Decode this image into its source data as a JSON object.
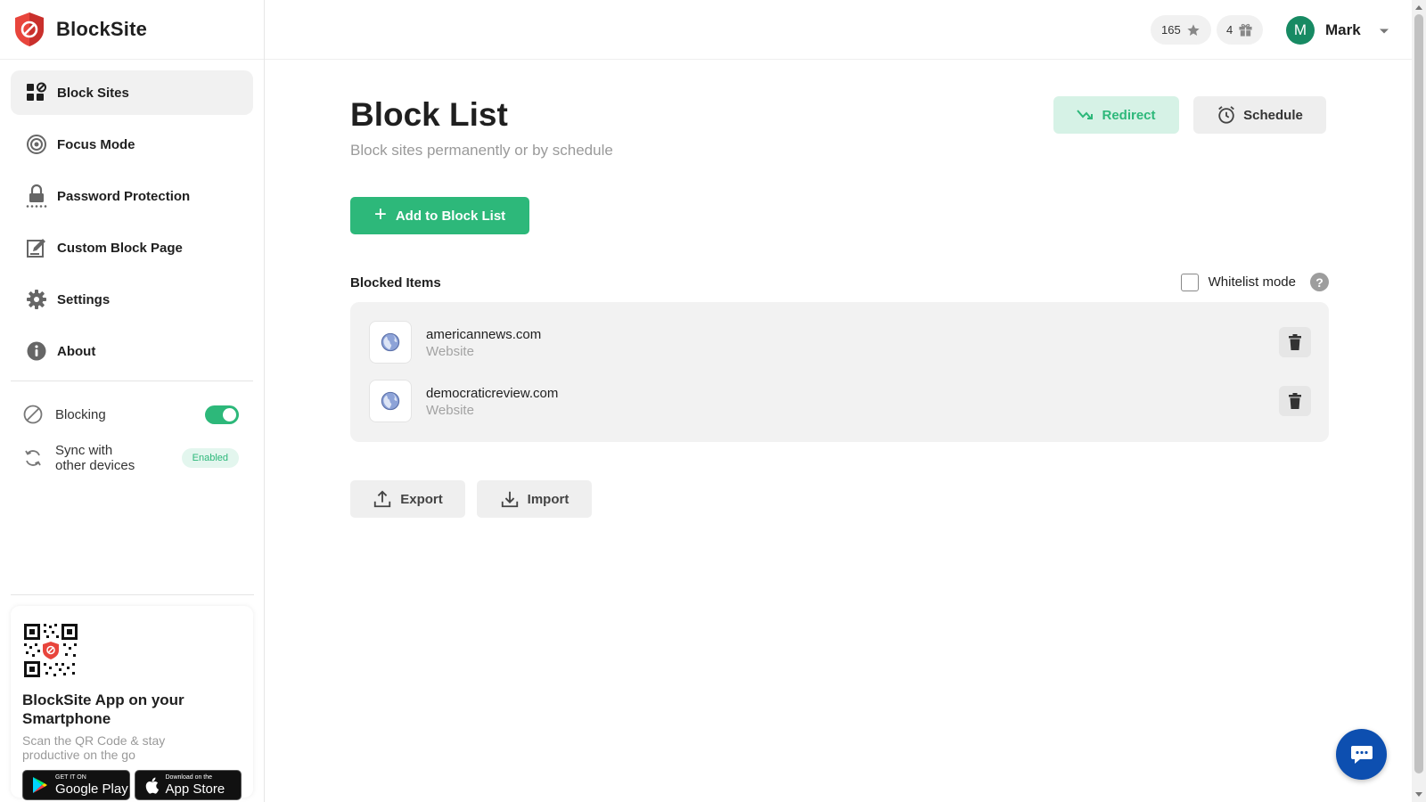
{
  "brand": {
    "name": "BlockSite"
  },
  "sidebar": {
    "items": [
      {
        "label": "Block Sites",
        "icon": "block-sites-icon",
        "active": true
      },
      {
        "label": "Focus Mode",
        "icon": "target-icon"
      },
      {
        "label": "Password Protection",
        "icon": "lock-icon"
      },
      {
        "label": "Custom Block Page",
        "icon": "edit-page-icon"
      },
      {
        "label": "Settings",
        "icon": "gear-icon"
      },
      {
        "label": "About",
        "icon": "info-icon"
      }
    ],
    "blocking": {
      "label": "Blocking",
      "on": true
    },
    "sync": {
      "label_line1": "Sync with",
      "label_line2": "other devices",
      "status": "Enabled"
    },
    "promo": {
      "title": "BlockSite App on your Smartphone",
      "subtitle": "Scan the QR Code & stay productive on the go",
      "google_small": "GET IT ON",
      "google_big": "Google Play",
      "apple_small": "Download on the",
      "apple_big": "App Store"
    }
  },
  "header": {
    "points": "165",
    "gifts": "4",
    "user_initial": "M",
    "user_name": "Mark"
  },
  "main": {
    "title": "Block List",
    "subtitle": "Block sites permanently or by schedule",
    "redirect_label": "Redirect",
    "schedule_label": "Schedule",
    "add_label": "Add to Block List",
    "blocked_items_title": "Blocked Items",
    "whitelist_label": "Whitelist mode",
    "whitelist_checked": false,
    "items": [
      {
        "name": "americannews.com",
        "type": "Website"
      },
      {
        "name": "democraticreview.com",
        "type": "Website"
      }
    ],
    "export_label": "Export",
    "import_label": "Import"
  },
  "colors": {
    "accent": "#2db87a",
    "chat": "#0d4fb0",
    "avatar": "#178a63",
    "logo": "#e8453c"
  }
}
